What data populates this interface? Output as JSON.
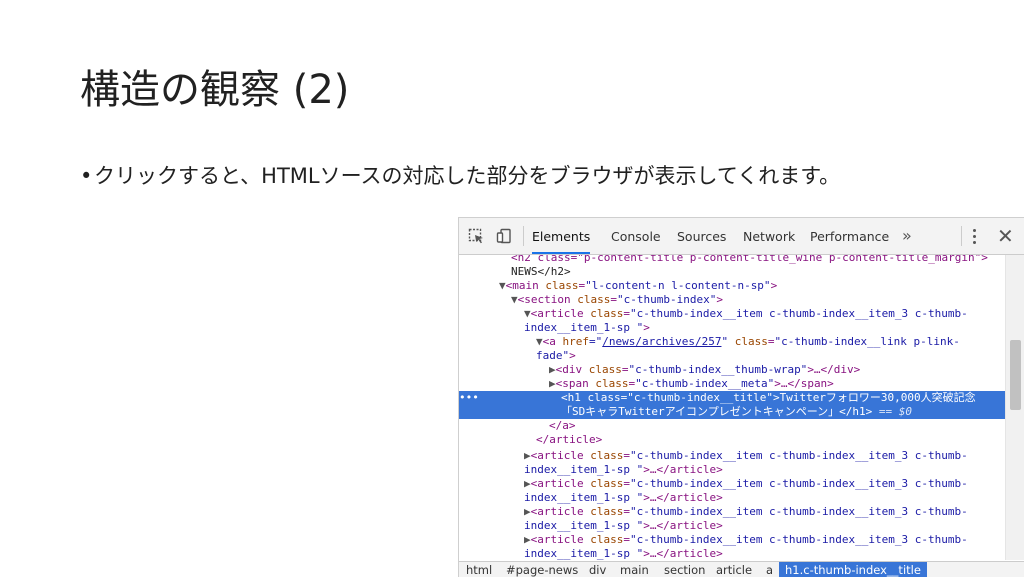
{
  "slide": {
    "title": "構造の観察 (2)",
    "bullet_dot": "•",
    "bullet": "クリックすると、HTMLソースの対応した部分をブラウザが表示してくれます。"
  },
  "devtools": {
    "tabs": [
      "Elements",
      "Console",
      "Sources",
      "Network",
      "Performance"
    ],
    "more": "»",
    "close": "✕",
    "selected_dots": "•••",
    "dom": {
      "l0": {
        "text": "<h2 class=\"p-content-title p-content-title_wine p-content-title_margin\">"
      },
      "l1": {
        "text": "NEWS</h2>"
      },
      "l2": {
        "tag_open": "<main",
        "attr": "class",
        "value": "\"l-content-n l-content-n-sp\"",
        "close": ">"
      },
      "l3": {
        "tag_open": "<section",
        "attr": "class",
        "value": "\"c-thumb-index\"",
        "close": ">"
      },
      "l4": {
        "tag_open": "<article",
        "attr": "class",
        "value": "\"c-thumb-index__item c-thumb-index__item_3 c-thumb-"
      },
      "l5": {
        "value": "index__item_1-sp \"",
        "close": ">"
      },
      "l6": {
        "tag_open": "<a",
        "attr": "href",
        "eq": "=\"",
        "link": "/news/archives/257",
        "q": "\"",
        "attr2": "class",
        "value2": "\"c-thumb-index__link p-link-"
      },
      "l7": {
        "value": "fade\"",
        "close": ">"
      },
      "l8": {
        "tag_open": "<div",
        "attr": "class",
        "value": "\"c-thumb-index__thumb-wrap\"",
        "close": ">…</div>"
      },
      "l9": {
        "tag_open": "<span",
        "attr": "class",
        "value": "\"c-thumb-index__meta\"",
        "close": ">…</span>"
      },
      "l10": {
        "tag_open": "<h1",
        "attr": "class",
        "value": "\"c-thumb-index__title\"",
        "close": ">",
        "text": "Twitterフォロワー30,000人突破記念"
      },
      "l11": {
        "text": "「SDキャラTwitterアイコンプレゼントキャンペーン」",
        "close": "</h1>",
        "eq": " == $0"
      },
      "l12": {
        "text": "</a>"
      },
      "l13": {
        "text": "</article>"
      },
      "article_open": "<article",
      "article_attr": "class",
      "article_value": "\"c-thumb-index__item c-thumb-index__item_3 c-thumb-",
      "article_value2": "index__item_1-sp \"",
      "article_close": ">…</article>"
    },
    "breadcrumbs": [
      "html",
      "#page-news",
      "div",
      "main",
      "section",
      "article",
      "a",
      "h1.c-thumb-index__title"
    ]
  }
}
